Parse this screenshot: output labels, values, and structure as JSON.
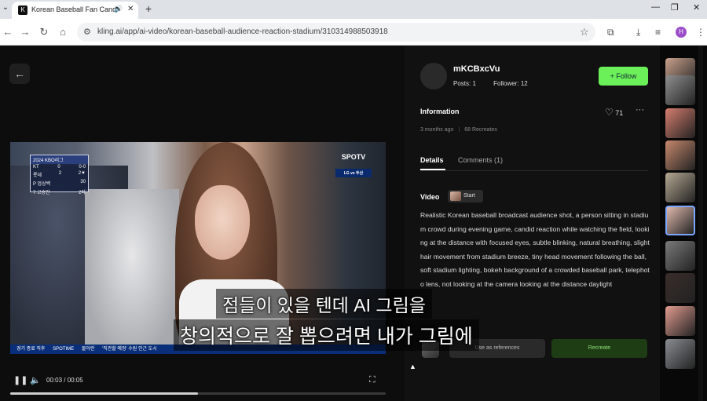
{
  "browser": {
    "tab_title": "Korean Baseball Fan Candid",
    "new_tab": "+",
    "url": "kling.ai/app/ai-video/korean-baseball-audience-reaction-stadium/310314988503918",
    "profile_initial": "H"
  },
  "video": {
    "scoreboard": {
      "header": "2024 KBO리그",
      "team1": "KT",
      "score1": "0",
      "team2": "롯데",
      "score2": "2",
      "inning": "2▼",
      "count": "0-0",
      "pitcher": "P 엄상백",
      "pitch_count": "30",
      "batter": "7 고승민",
      "batter_stat": "2타"
    },
    "broadcaster": "SPOTV",
    "broadcaster_sub": "LG vs 두산",
    "ticker": [
      "경기 종료 직후",
      "SPOTIME",
      "몰아란",
      "'직관할 예정' 수원 인근 도시"
    ],
    "time": "00:03 / 00:05",
    "progress": 0.5
  },
  "author": {
    "username": "mKCBxcVu",
    "posts_label": "Posts: 1",
    "followers_label": "Follower: 12",
    "follow_label": "Follow"
  },
  "information": {
    "heading": "Information",
    "likes": "71",
    "time_ago": "3 months ago",
    "recreates": "68 Recreates"
  },
  "tabs": {
    "details": "Details",
    "comments": "Comments (1)"
  },
  "details": {
    "section_label": "Video",
    "start_label": "Start",
    "prompt": "Realistic Korean baseball broadcast audience shot, a person sitting in stadium crowd during evening game, candid reaction while watching the field, looking at the distance with focused eyes, subtle blinking, natural breathing, slight hair movement from stadium breeze, tiny head movement following the ball, soft stadium lighting, bokeh background of a crowded baseball park, telephoto lens, not looking at the camera looking at the distance daylight"
  },
  "actions": {
    "use_refs": "Use as references",
    "recreate": "Recreate"
  },
  "captions": {
    "line1": "점들이 있을 텐데 AI 그림을",
    "line2": "창의적으로 잘 뽑으려면 내가 그림에"
  },
  "thumb_colors": [
    "#c9a18d",
    "#8f8f8f",
    "#d57d6e",
    "#c7886d",
    "#b5a892",
    "#dfb9ad",
    "#7a7a7a",
    "#3a2d2a",
    "#e19b8f",
    "#8a8d92"
  ]
}
